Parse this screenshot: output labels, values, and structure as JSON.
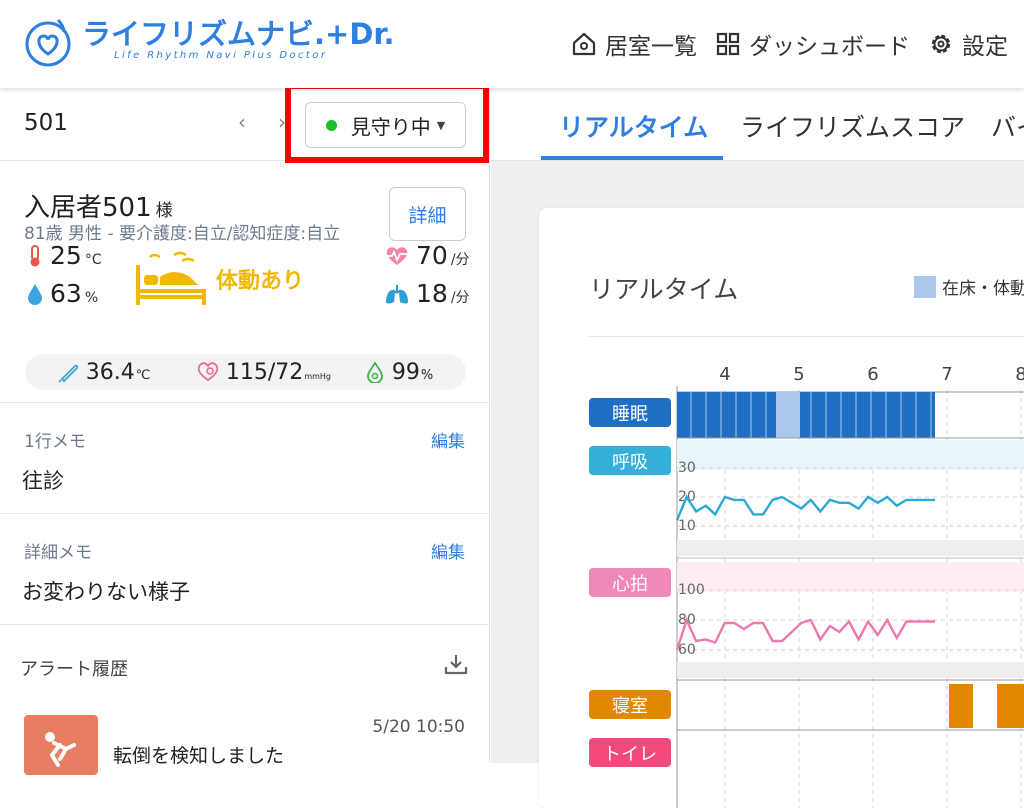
{
  "header": {
    "logo_text": "ライフリズムナビ.+Dr.",
    "logo_sub": "Life Rhythm Navi Plus Doctor",
    "nav": [
      {
        "icon": "home-icon",
        "label": "居室一覧"
      },
      {
        "icon": "dashboard-icon",
        "label": "ダッシュボード"
      },
      {
        "icon": "gear-icon",
        "label": "設定"
      }
    ]
  },
  "room": {
    "number": "501",
    "prev": "‹",
    "next": "›",
    "status": "見守り中",
    "status_color": "#1cbf2a"
  },
  "resident": {
    "name": "入居者501",
    "honorific": "様",
    "info": "81歳 男性 - 要介護度:自立/認知症度:自立",
    "detail_button": "詳細",
    "temperature": {
      "value": "25",
      "unit": "°C"
    },
    "humidity": {
      "value": "63",
      "unit": "%"
    },
    "movement": "体動あり",
    "heart_rate": {
      "value": "70",
      "unit": "/分"
    },
    "respiration": {
      "value": "18",
      "unit": "/分"
    },
    "body_temp": {
      "value": "36.4",
      "unit": "℃"
    },
    "blood_pressure": {
      "value": "115/72",
      "unit": "mmHg"
    },
    "spo2": {
      "value": "99",
      "unit": "%"
    }
  },
  "memo_one_line": {
    "label": "1行メモ",
    "edit": "編集",
    "text": "往診"
  },
  "memo_detail": {
    "label": "詳細メモ",
    "edit": "編集",
    "text": "お変わりない様子"
  },
  "alerts": {
    "title": "アラート履歴",
    "items": [
      {
        "time": "5/20 10:50",
        "message": "転倒を検知しました"
      }
    ]
  },
  "tabs": [
    {
      "label": "リアルタイム",
      "active": true
    },
    {
      "label": "ライフリズムスコア",
      "active": false
    },
    {
      "label": "バイ",
      "active": false
    }
  ],
  "card": {
    "title": "リアルタイム",
    "legend": "在床・体動"
  },
  "chart_data": {
    "type": "line",
    "x_ticks": [
      "4",
      "5",
      "6",
      "7",
      "8"
    ],
    "rows": [
      {
        "name": "睡眠",
        "color": "#1e6fc4"
      },
      {
        "name": "呼吸",
        "color": "#33afd8"
      },
      {
        "name": "心拍",
        "color": "#f189b8"
      },
      {
        "name": "寝室",
        "color": "#e38600"
      },
      {
        "name": "トイレ",
        "color": "#f24a7a"
      }
    ],
    "respiration": {
      "yticks": [
        30,
        20,
        10
      ],
      "values": [
        12,
        20,
        15,
        17,
        14,
        20,
        19,
        19,
        14,
        14,
        19,
        20,
        18,
        16,
        19,
        15,
        19,
        18,
        18,
        16,
        20,
        18,
        20,
        17,
        19,
        19,
        19,
        19
      ]
    },
    "heart": {
      "yticks": [
        100,
        80,
        60
      ],
      "values": [
        60,
        80,
        66,
        67,
        65,
        78,
        78,
        74,
        78,
        78,
        66,
        66,
        72,
        78,
        80,
        67,
        76,
        72,
        79,
        67,
        79,
        70,
        80,
        68,
        79,
        79,
        79,
        79
      ]
    }
  }
}
